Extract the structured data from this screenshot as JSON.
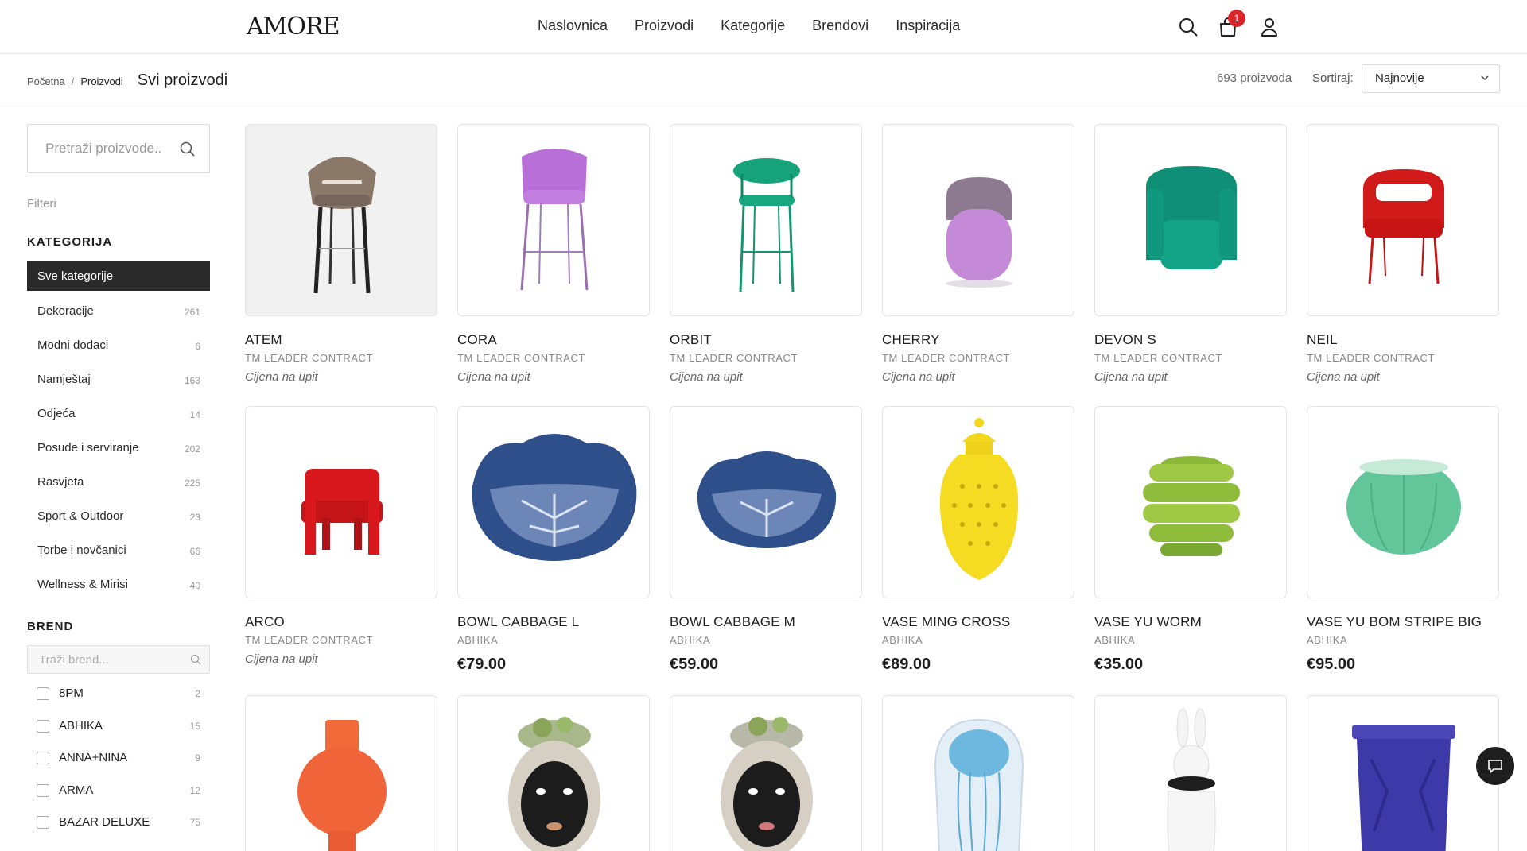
{
  "header": {
    "logo": "AMORE",
    "nav": [
      "Naslovnica",
      "Proizvodi",
      "Kategorije",
      "Brendovi",
      "Inspiracija"
    ],
    "cart_count": "1",
    "icons": [
      "search-icon",
      "cart-icon",
      "user-icon"
    ]
  },
  "subbar": {
    "breadcrumb": [
      "Početna",
      "Proizvodi"
    ],
    "separator": "/",
    "title": "Svi proizvodi",
    "count": "693 proizvoda",
    "sort_label": "Sortiraj:",
    "sort_value": "Najnovije"
  },
  "sidebar": {
    "search_placeholder": "Pretraži proizvode..",
    "filters_label": "Filteri",
    "category_title": "KATEGORIJA",
    "categories": [
      {
        "label": "Sve kategorije",
        "count": ""
      },
      {
        "label": "Dekoracije",
        "count": "261"
      },
      {
        "label": "Modni dodaci",
        "count": "6"
      },
      {
        "label": "Namještaj",
        "count": "163"
      },
      {
        "label": "Odjeća",
        "count": "14"
      },
      {
        "label": "Posude i serviranje",
        "count": "202"
      },
      {
        "label": "Rasvjeta",
        "count": "225"
      },
      {
        "label": "Sport & Outdoor",
        "count": "23"
      },
      {
        "label": "Torbe i novčanici",
        "count": "66"
      },
      {
        "label": "Wellness & Mirisi",
        "count": "40"
      }
    ],
    "brand_title": "BREND",
    "brand_search_placeholder": "Traži brend...",
    "brands": [
      {
        "label": "8PM",
        "count": "2"
      },
      {
        "label": "ABHIKA",
        "count": "15"
      },
      {
        "label": "ANNA+NINA",
        "count": "9"
      },
      {
        "label": "ARMA",
        "count": "12"
      },
      {
        "label": "BAZAR DELUXE",
        "count": "75"
      }
    ]
  },
  "products": [
    {
      "name": "ATEM",
      "brand": "TM LEADER CONTRACT",
      "price": "Cijena na upit",
      "on_request": true,
      "image": "bar-stool-taupe"
    },
    {
      "name": "CORA",
      "brand": "TM LEADER CONTRACT",
      "price": "Cijena na upit",
      "on_request": true,
      "image": "bar-stool-lilac"
    },
    {
      "name": "ORBIT",
      "brand": "TM LEADER CONTRACT",
      "price": "Cijena na upit",
      "on_request": true,
      "image": "bar-stool-green"
    },
    {
      "name": "CHERRY",
      "brand": "TM LEADER CONTRACT",
      "price": "Cijena na upit",
      "on_request": true,
      "image": "pouf-lilac"
    },
    {
      "name": "DEVON S",
      "brand": "TM LEADER CONTRACT",
      "price": "Cijena na upit",
      "on_request": true,
      "image": "armchair-teal"
    },
    {
      "name": "NEIL",
      "brand": "TM LEADER CONTRACT",
      "price": "Cijena na upit",
      "on_request": true,
      "image": "chair-red"
    },
    {
      "name": "ARCO",
      "brand": "TM LEADER CONTRACT",
      "price": "Cijena na upit",
      "on_request": true,
      "image": "armchair-red"
    },
    {
      "name": "BOWL CABBAGE L",
      "brand": "ABHIKA",
      "price": "€79.00",
      "on_request": false,
      "image": "bowl-cabbage-blue"
    },
    {
      "name": "BOWL CABBAGE M",
      "brand": "ABHIKA",
      "price": "€59.00",
      "on_request": false,
      "image": "bowl-cabbage-blue-small"
    },
    {
      "name": "VASE MING CROSS",
      "brand": "ABHIKA",
      "price": "€89.00",
      "on_request": false,
      "image": "vase-yellow"
    },
    {
      "name": "VASE YU WORM",
      "brand": "ABHIKA",
      "price": "€35.00",
      "on_request": false,
      "image": "vase-green-ribbed"
    },
    {
      "name": "VASE YU BOM STRIPE BIG",
      "brand": "ABHIKA",
      "price": "€95.00",
      "on_request": false,
      "image": "vase-mint"
    },
    {
      "name": "",
      "brand": "",
      "price": "",
      "on_request": false,
      "image": "vase-orange"
    },
    {
      "name": "",
      "brand": "",
      "price": "",
      "on_request": false,
      "image": "head-vase"
    },
    {
      "name": "",
      "brand": "",
      "price": "",
      "on_request": false,
      "image": "head-vase"
    },
    {
      "name": "",
      "brand": "",
      "price": "",
      "on_request": false,
      "image": "jellyfish-glass"
    },
    {
      "name": "",
      "brand": "",
      "price": "",
      "on_request": false,
      "image": "rabbit-figure"
    },
    {
      "name": "",
      "brand": "",
      "price": "",
      "on_request": false,
      "image": "stool-blue"
    }
  ],
  "colors": {
    "accent": "#2a2a2a",
    "badge": "#d9262b"
  }
}
